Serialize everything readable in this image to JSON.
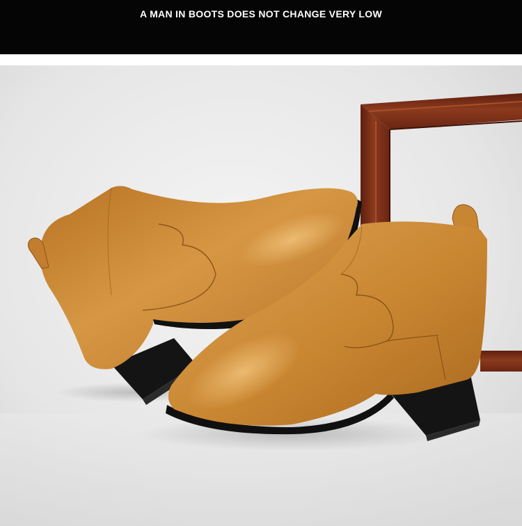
{
  "banner": {
    "title": "A MAN IN BOOTS DOES NOT CHANGE VERY LOW"
  },
  "photo": {
    "subject": "pair-of-tan-leather-chelsea-ankle-boots",
    "colors": {
      "banner_bg": "#050505",
      "backdrop": "#e8e8e8",
      "leather": "#c9862f",
      "frame_wood": "#7a2c16",
      "sole": "#151515"
    }
  }
}
